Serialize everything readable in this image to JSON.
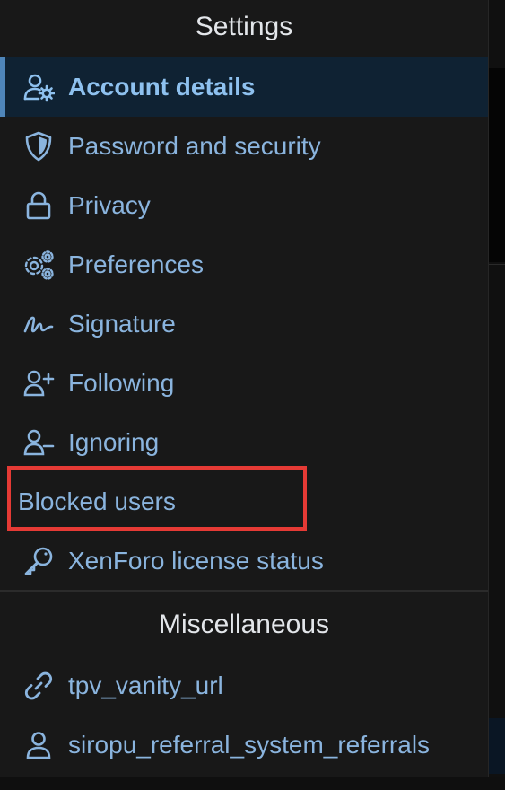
{
  "settings": {
    "title": "Settings",
    "items": [
      {
        "label": "Account details",
        "icon": "user-gear-icon",
        "active": true
      },
      {
        "label": "Password and security",
        "icon": "shield-icon",
        "active": false
      },
      {
        "label": "Privacy",
        "icon": "lock-icon",
        "active": false
      },
      {
        "label": "Preferences",
        "icon": "gears-icon",
        "active": false
      },
      {
        "label": "Signature",
        "icon": "signature-icon",
        "active": false
      },
      {
        "label": "Following",
        "icon": "user-plus-icon",
        "active": false
      },
      {
        "label": "Ignoring",
        "icon": "user-minus-icon",
        "active": false
      },
      {
        "label": "Blocked users",
        "icon": null,
        "active": false
      },
      {
        "label": "XenForo license status",
        "icon": "key-icon",
        "active": false
      }
    ]
  },
  "miscellaneous": {
    "title": "Miscellaneous",
    "items": [
      {
        "label": "tpv_vanity_url",
        "icon": "link-icon"
      },
      {
        "label": "siropu_referral_system_referrals",
        "icon": "user-icon"
      }
    ]
  },
  "colors": {
    "background": "#181818",
    "link": "#8ab4de",
    "active_background": "#0f2233",
    "active_border": "#4f86ba",
    "heading": "#e3e6ea",
    "highlight_box": "#e53a35"
  }
}
